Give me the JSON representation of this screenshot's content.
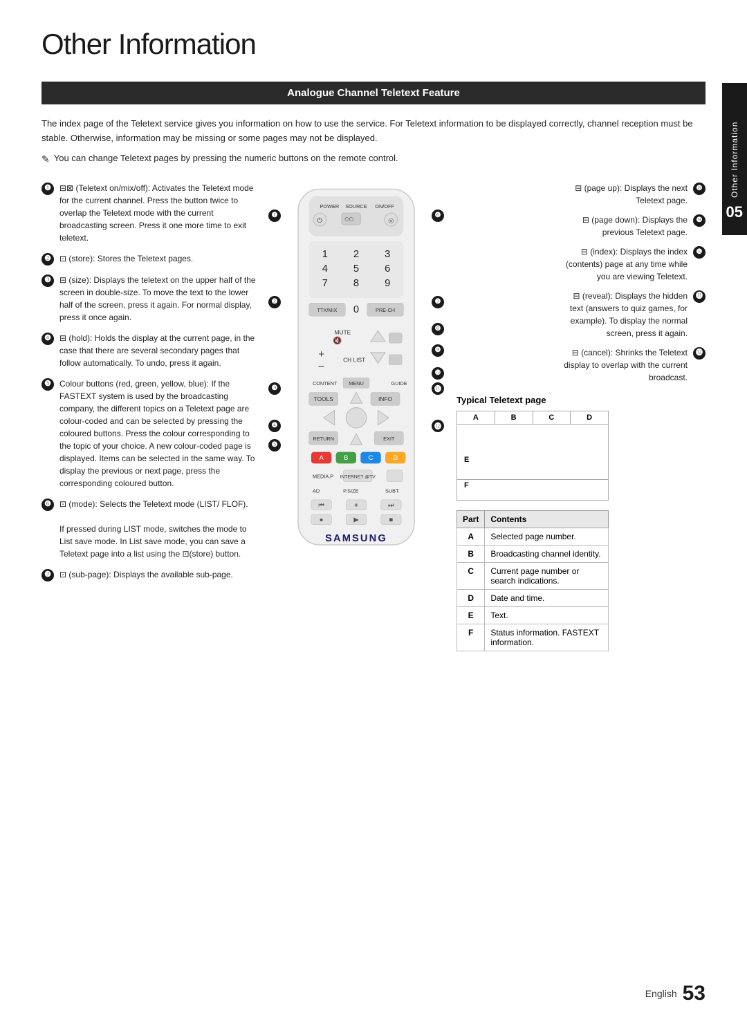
{
  "page": {
    "title": "Other Information",
    "section_header": "Analogue Channel Teletext Feature",
    "side_tab_number": "05",
    "side_tab_text": "Other Information",
    "footer_label": "English",
    "footer_page": "53"
  },
  "intro": {
    "paragraph": "The index page of the Teletext service gives you information on how to use the service. For Teletext information to be displayed correctly, channel reception must be stable. Otherwise, information may be missing or some pages may not be displayed.",
    "note": "You can change Teletext pages by pressing the numeric buttons on the remote control."
  },
  "left_items": [
    {
      "num": "1",
      "text": "(Teletext on/mix/off): Activates the Teletext mode for the current channel. Press the button twice to overlap the Teletext mode with the current broadcasting screen. Press it one more time to exit teletext."
    },
    {
      "num": "2",
      "text": "(store): Stores the Teletext pages."
    },
    {
      "num": "3",
      "text": "(size): Displays the teletext on the upper half of the screen in double-size. To move the text to the lower half of the screen, press it again. For normal display, press it once again."
    },
    {
      "num": "4",
      "text": "(hold): Holds the display at the current page, in the case that there are several secondary pages that follow automatically. To undo, press it again."
    },
    {
      "num": "5",
      "text": "Colour buttons (red, green, yellow, blue): If the FASTEXT system is used by the broadcasting company, the different topics on a Teletext page are colour-coded and can be selected by pressing the coloured buttons. Press the colour corresponding to the topic of your choice. A new colour-coded page is displayed. Items can be selected in the same way. To display the previous or next page, press the corresponding coloured button."
    },
    {
      "num": "6",
      "text": "(mode): Selects the Teletext mode (LIST/ FLOF).\nIf pressed during LIST mode, switches the mode to List save mode. In List save mode, you can save a Teletext page into a list using the (store) button."
    },
    {
      "num": "7",
      "text": "(sub-page): Displays the available sub-page."
    }
  ],
  "right_items": [
    {
      "num": "8",
      "text": "(page up): Displays the next Teletext page."
    },
    {
      "num": "9",
      "text": "(page down): Displays the previous Teletext page."
    },
    {
      "num": "10",
      "text": "(index): Displays the index (contents) page at any time while you are viewing Teletext."
    },
    {
      "num": "11",
      "text": "(reveal): Displays the hidden text (answers to quiz games, for example). To display the normal screen, press it again."
    },
    {
      "num": "12",
      "text": "(cancel): Shrinks the Teletext display to overlap with the current broadcast."
    }
  ],
  "teletext_page": {
    "title": "Typical Teletext page",
    "columns": [
      "A",
      "B",
      "C",
      "D"
    ],
    "e_label": "E",
    "f_label": "F"
  },
  "table": {
    "headers": [
      "Part",
      "Contents"
    ],
    "rows": [
      {
        "part": "A",
        "contents": "Selected page number."
      },
      {
        "part": "B",
        "contents": "Broadcasting channel identity."
      },
      {
        "part": "C",
        "contents": "Current page number or search indications."
      },
      {
        "part": "D",
        "contents": "Date and time."
      },
      {
        "part": "E",
        "contents": "Text."
      },
      {
        "part": "F",
        "contents": "Status information. FASTEXT information."
      }
    ]
  }
}
